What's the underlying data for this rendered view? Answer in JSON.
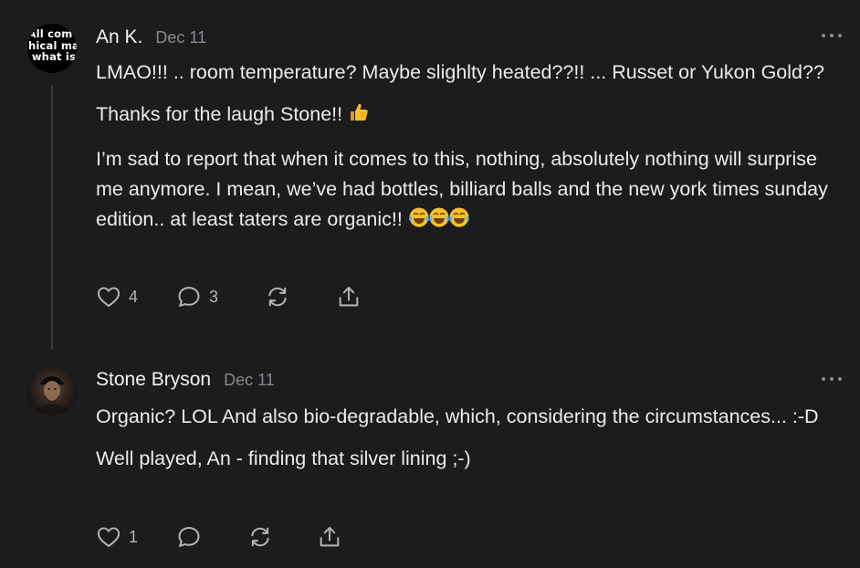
{
  "comments": [
    {
      "author": "An K.",
      "date": "Dec 11",
      "avatar_text": [
        "All come",
        "hical ma",
        "what is"
      ],
      "paragraphs": [
        "LMAO!!! .. room temperature? Maybe slighlty heated??!! ... Russet or Yukon Gold??",
        "Thanks for the laugh Stone!!",
        "I’m sad to report that when it comes to this, nothing, absolutely nothing will surprise me anymore. I mean, we’ve had bottles, billiard balls and the new york times sunday edition.. at least taters are organic!!"
      ],
      "likes": "4",
      "replies": "3"
    },
    {
      "author": "Stone Bryson",
      "date": "Dec 11",
      "paragraphs": [
        "Organic? LOL And also bio-degradable, which, considering the circumstances... :-D",
        "Well played, An - finding that silver lining ;-)"
      ],
      "likes": "1",
      "replies": ""
    }
  ],
  "icons": {
    "like": "heart-icon",
    "reply": "comment-bubble-icon",
    "restack": "restack-icon",
    "share": "share-icon",
    "more": "more-dots-icon",
    "thumbs_up": "thumbs-up-emoji",
    "laughing": "tears-of-joy-emoji"
  },
  "colors": {
    "background": "#1c1c1e",
    "text": "#ececec",
    "muted": "#8a8a8e",
    "thread_line": "#3a3a3d",
    "emoji_yellow": "#f7c02b"
  }
}
